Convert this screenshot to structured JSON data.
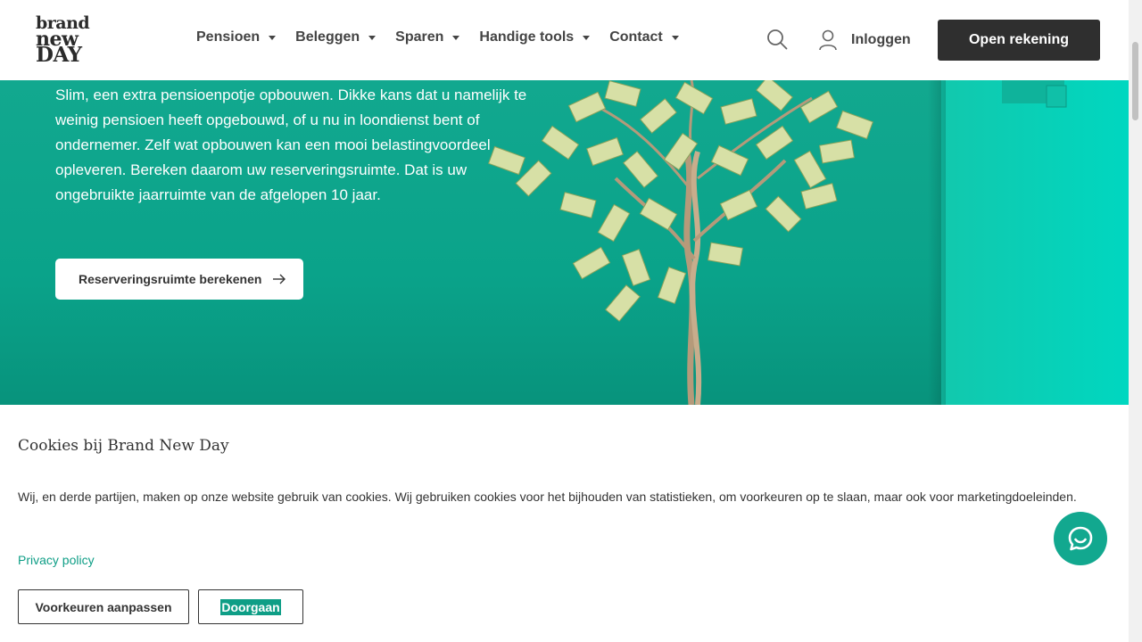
{
  "logo": {
    "line1": "brand",
    "line2": "new",
    "line3": "DAY"
  },
  "nav": {
    "items": [
      {
        "label": "Pensioen"
      },
      {
        "label": "Beleggen"
      },
      {
        "label": "Sparen"
      },
      {
        "label": "Handige tools"
      },
      {
        "label": "Contact"
      }
    ],
    "login_label": "Inloggen",
    "open_account_label": "Open rekening"
  },
  "hero": {
    "line1": "Slim, een extra pensioenpotje opbouwen. Dikke kans dat u namelijk te",
    "line2": "weinig pensioen heeft opgebouwd, of u nu in loondienst bent of",
    "line3": "ondernemer. Zelf wat opbouwen kan een mooi belastingvoordeel",
    "line4": "opleveren. Bereken daarom uw reserveringsruimte. Dat is uw",
    "line5": "ongebruikte jaarruimte van de afgelopen 10 jaar.",
    "button_label": "Reserveringsruimte berekenen"
  },
  "cookie": {
    "title": "Cookies bij Brand New Day",
    "text": "Wij, en derde partijen, maken op onze website gebruik van cookies. Wij gebruiken cookies voor het bijhouden van statistieken, om voorkeuren op te slaan, maar ook voor marketingdoeleinden.",
    "privacy_label": "Privacy policy",
    "preferences_label": "Voorkeuren aanpassen",
    "continue_label": "Doorgaan"
  },
  "colors": {
    "brand_green": "#12a88f",
    "dark_button": "#2f2f2f"
  }
}
